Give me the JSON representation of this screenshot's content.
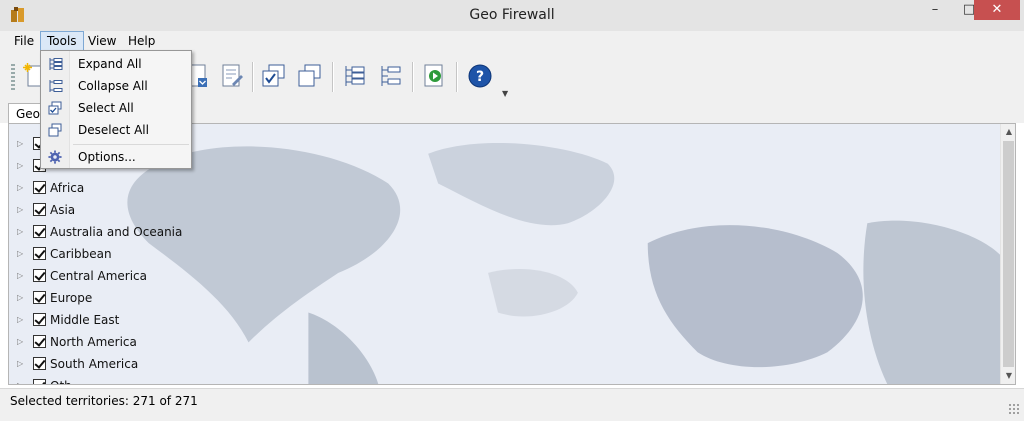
{
  "window": {
    "title": "Geo Firewall"
  },
  "menu": {
    "file": "File",
    "tools": "Tools",
    "view": "View",
    "help": "Help"
  },
  "tools_menu": {
    "items": [
      {
        "label": "Expand All",
        "icon": "expand-tree-icon"
      },
      {
        "label": "Collapse All",
        "icon": "collapse-tree-icon"
      },
      {
        "label": "Select All",
        "icon": "select-all-icon"
      },
      {
        "label": "Deselect All",
        "icon": "deselect-all-icon"
      },
      {
        "label": "Options...",
        "icon": "gear-icon"
      }
    ]
  },
  "tab": {
    "label": "Geo"
  },
  "tree": {
    "items": [
      {
        "label": "",
        "checked": true
      },
      {
        "label": "",
        "checked": true
      },
      {
        "label": "Africa",
        "checked": true
      },
      {
        "label": "Asia",
        "checked": true
      },
      {
        "label": "Australia and Oceania",
        "checked": true
      },
      {
        "label": "Caribbean",
        "checked": true
      },
      {
        "label": "Central America",
        "checked": true
      },
      {
        "label": "Europe",
        "checked": true
      },
      {
        "label": "Middle East",
        "checked": true
      },
      {
        "label": "North America",
        "checked": true
      },
      {
        "label": "South America",
        "checked": true
      },
      {
        "label": "Oth",
        "checked": true
      }
    ]
  },
  "status": {
    "text": "Selected territories: 271 of 271"
  },
  "colors": {
    "accent": "#1e6fc7",
    "close": "#c75050",
    "map_land": "#9aa3b4",
    "map_water": "#e6ebf4"
  }
}
